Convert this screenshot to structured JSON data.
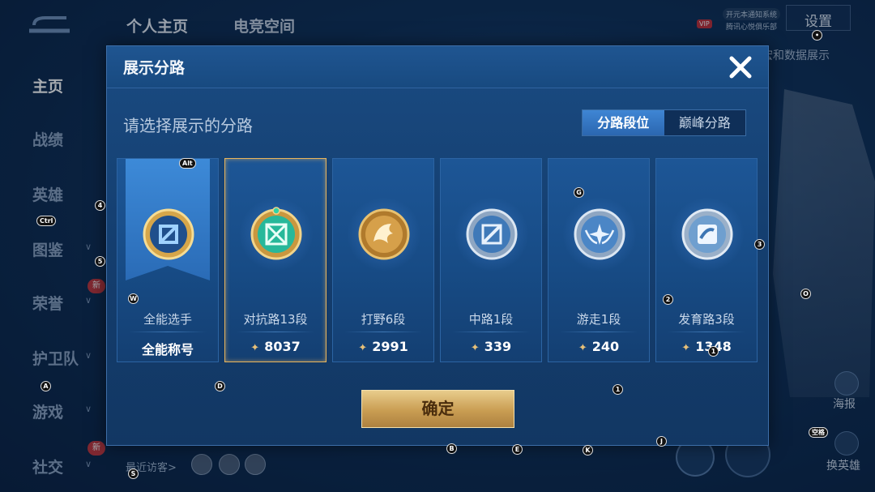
{
  "background": {
    "tabs": [
      "个人主页",
      "电竞空间"
    ],
    "vip": {
      "badge": "VIP",
      "line1": "开元本通知系统",
      "line2": "腾讯心悦俱乐部"
    },
    "settings_label": "设置",
    "subtitle": "宏和数据展示",
    "sidebar": [
      {
        "label": "主页",
        "active": true
      },
      {
        "label": "战绩"
      },
      {
        "label": "英雄"
      },
      {
        "label": "图鉴",
        "chevron": true
      },
      {
        "label": "荣誉",
        "chevron": true,
        "badge": "新"
      },
      {
        "label": "护卫队",
        "chevron": true
      },
      {
        "label": "游戏",
        "chevron": true
      },
      {
        "label": "社交",
        "chevron": true,
        "badge": "新"
      }
    ],
    "visitors_label": "最近访客>",
    "right_labels": {
      "poster": "海报",
      "swap_hero": "换英雄"
    }
  },
  "modal": {
    "title": "展示分路",
    "prompt": "请选择展示的分路",
    "toggle": {
      "options": [
        "分路段位",
        "巅峰分路"
      ],
      "active": 0
    },
    "cards": [
      {
        "name": "全能选手",
        "footer": "全能称号",
        "emblem": "all-round-emblem",
        "selected": false
      },
      {
        "name": "对抗路13段",
        "footer": "8037",
        "emblem": "clash-lane-emblem",
        "selected": true
      },
      {
        "name": "打野6段",
        "footer": "2991",
        "emblem": "jungle-emblem",
        "selected": false
      },
      {
        "name": "中路1段",
        "footer": "339",
        "emblem": "mid-lane-emblem",
        "selected": false
      },
      {
        "name": "游走1段",
        "footer": "240",
        "emblem": "roam-emblem",
        "selected": false
      },
      {
        "name": "发育路3段",
        "footer": "1348",
        "emblem": "farm-lane-emblem",
        "selected": false
      }
    ],
    "confirm_label": "确定"
  },
  "shortcut_keys": {
    "alt": "Alt",
    "ctrl": "Ctrl",
    "k4": "4",
    "k5": "5",
    "w": "W",
    "a": "A",
    "s": "S",
    "d": "D",
    "g": "G",
    "k3": "3",
    "k2": "2",
    "k1a": "1",
    "k1b": "1",
    "o": "O",
    "b": "B",
    "e": "E",
    "k": "K",
    "j": "J",
    "space": "空格",
    "dot": "•"
  },
  "colors": {
    "accent_gold": "#e8b45c",
    "toggle_active": "#3f86d4",
    "confirm_gold": "#c99d52"
  }
}
